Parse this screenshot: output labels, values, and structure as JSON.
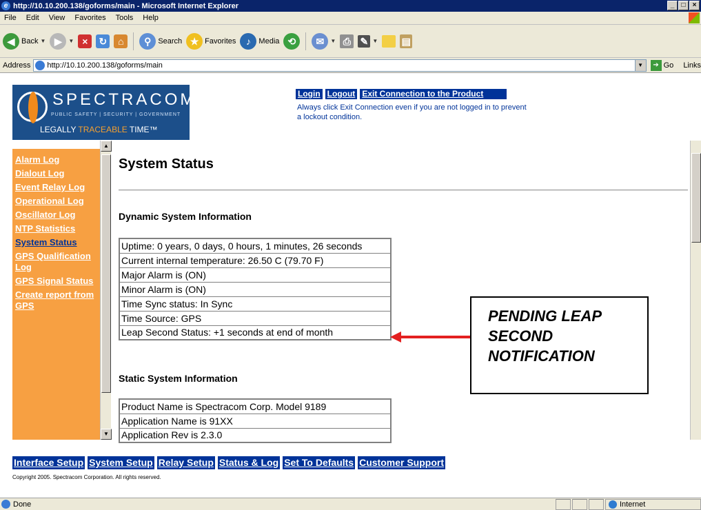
{
  "window": {
    "title": "http://10.10.200.138/goforms/main - Microsoft Internet Explorer"
  },
  "menu": [
    "File",
    "Edit",
    "View",
    "Favorites",
    "Tools",
    "Help"
  ],
  "toolbar": {
    "back_label": "Back",
    "search_label": "Search",
    "favorites_label": "Favorites",
    "media_label": "Media"
  },
  "addressbar": {
    "label": "Address",
    "url": "http://10.10.200.138/goforms/main",
    "go_label": "Go",
    "links_label": "Links"
  },
  "logo": {
    "brand": "SPECTRACOM",
    "tagline": "PUBLIC SAFETY | SECURITY | GOVERNMENT",
    "slogan_pre": "LEGALLY ",
    "slogan_highlight": "TRACEABLE",
    "slogan_post": " TIME™"
  },
  "topnav": {
    "login": "Login",
    "logout": "Logout",
    "exit": "Exit Connection to the Product",
    "note": "Always click Exit Connection even if you are not logged in to prevent a lockout condition."
  },
  "sidebar": {
    "items": [
      "Alarm Log",
      "Dialout Log",
      "Event Relay Log",
      "Operational Log",
      "Oscillator Log",
      "NTP Statistics",
      "System Status",
      "GPS Qualification Log",
      "GPS Signal Status",
      "Create report from GPS"
    ]
  },
  "main": {
    "title": "System Status",
    "dynamic_title": "Dynamic System Information",
    "dynamic_rows": [
      "Uptime: 0 years, 0 days, 0 hours, 1 minutes, 26 seconds",
      "Current internal temperature: 26.50 C (79.70 F)",
      "Major Alarm is (ON)",
      "Minor Alarm is (ON)",
      "Time Sync status: In Sync",
      "Time Source: GPS",
      "Leap Second Status: +1 seconds at end of month"
    ],
    "static_title": "Static System Information",
    "static_rows": [
      "Product Name is Spectracom Corp. Model 9189",
      "Application Name is 91XX",
      "Application Rev is 2.3.0"
    ]
  },
  "callout": {
    "line1": "PENDING LEAP",
    "line2": "SECOND",
    "line3": "NOTIFICATION"
  },
  "bottomnav": {
    "interface": "Interface Setup",
    "system": "System Setup",
    "relay": "Relay Setup",
    "status": "Status & Log",
    "defaults": "Set To Defaults",
    "support": "Customer Support"
  },
  "copyright": "Copyright 2005. Spectracom Corporation. All rights reserved.",
  "statusbar": {
    "status": "Done",
    "zone": "Internet"
  },
  "colors": {
    "sidebar_bg": "#f7a042",
    "nav_bg": "#003399",
    "callout_arrow": "#e32020"
  }
}
